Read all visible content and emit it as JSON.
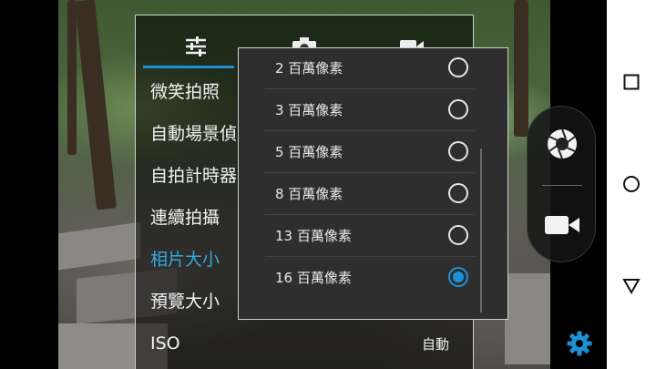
{
  "settings_menu": {
    "tabs": [
      {
        "icon": "sliders-icon"
      },
      {
        "icon": "camera-icon"
      },
      {
        "icon": "video-camera-icon"
      }
    ],
    "items": [
      {
        "label": "微笑拍照"
      },
      {
        "label": "自動場景偵"
      },
      {
        "label": "自拍計時器"
      },
      {
        "label": "連續拍攝"
      },
      {
        "label": "相片大小"
      },
      {
        "label": "預覽大小"
      },
      {
        "label": "ISO",
        "value": "自動"
      }
    ],
    "active_item": "相片大小"
  },
  "photo_size_dialog": {
    "options": [
      {
        "label": "2 百萬像素",
        "selected": false
      },
      {
        "label": "3 百萬像素",
        "selected": false
      },
      {
        "label": "5 百萬像素",
        "selected": false
      },
      {
        "label": "8 百萬像素",
        "selected": false
      },
      {
        "label": "13 百萬像素",
        "selected": false
      },
      {
        "label": "16 百萬像素",
        "selected": true
      }
    ]
  },
  "capture_controls": {
    "photo_icon": "shutter-aperture-icon",
    "video_icon": "video-camera-icon",
    "settings_icon": "gear-icon"
  },
  "nav_bar": {
    "recents_icon": "square-icon",
    "home_icon": "circle-icon",
    "back_icon": "triangle-back-icon"
  },
  "colors": {
    "accent": "#1e90d6",
    "active_text": "#35a6e6",
    "gear": "#1e90d6"
  }
}
